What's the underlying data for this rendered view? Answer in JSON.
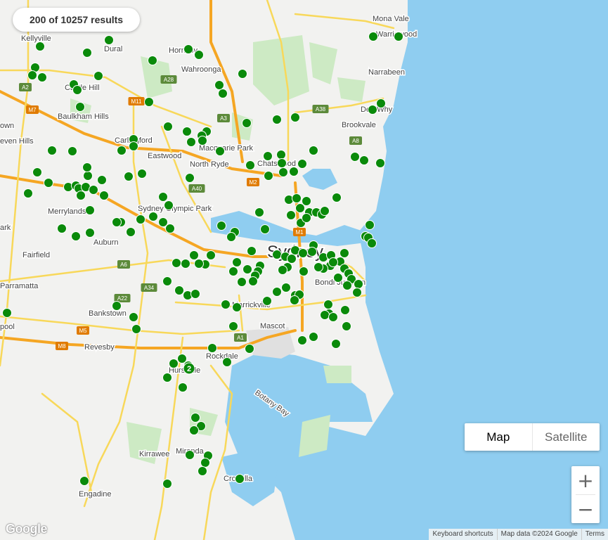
{
  "results": {
    "text": "200 of 10257 results"
  },
  "map_type": {
    "map_label": "Map",
    "satellite_label": "Satellite",
    "selected": "Map"
  },
  "zoom": {
    "in_label": "+",
    "out_label": "−"
  },
  "footer": {
    "keyboard": "Keyboard shortcuts",
    "map_data": "Map data ©2024 Google",
    "terms": "Terms"
  },
  "logo": "Google",
  "colors": {
    "marker": "#0a8a0a",
    "water": "#8fcdf0",
    "land": "#f2f2f0",
    "park": "#cdeac4",
    "freeway": "#f5a623",
    "road": "#f8d85a"
  },
  "place_labels": [
    "Mona Vale",
    "Warriewood",
    "Narrabeen",
    "Dee Why",
    "Brookvale",
    "Kellyville",
    "Dural",
    "Hornsby",
    "Wahroonga",
    "Castle Hill",
    "Baulkham Hills",
    "Carlingford",
    "Eastwood",
    "Macquarie Park",
    "North Ryde",
    "Chatswood",
    "Merrylands",
    "Sydney Olympic Park",
    "Auburn",
    "Fairfield",
    "Parramatta",
    "Bankstown",
    "Revesby",
    "Sydney",
    "Bondi Junction",
    "Marrickville",
    "Mascot",
    "Rockdale",
    "Hurstville",
    "Botany Bay",
    "Kirrawee",
    "Miranda",
    "Engadine",
    "Cronulla",
    "own",
    "even Hills",
    "ark",
    "pool"
  ],
  "road_shields": [
    "A2",
    "M7",
    "M11",
    "A28",
    "A3",
    "A38",
    "A8",
    "M2",
    "A40",
    "M1",
    "A6",
    "A22",
    "A34",
    "M5",
    "M8",
    "A1"
  ],
  "cluster_label": "2",
  "marker_count": 200
}
